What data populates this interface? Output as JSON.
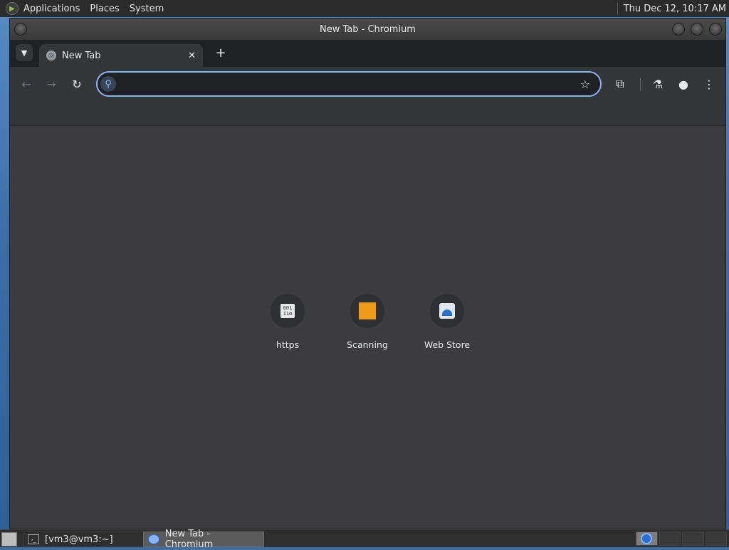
{
  "top_panel": {
    "menus": [
      "Applications",
      "Places",
      "System"
    ],
    "clock": "Thu Dec 12, 10:17 AM"
  },
  "window": {
    "title": "New Tab - Chromium"
  },
  "tabs": [
    {
      "title": "New Tab"
    }
  ],
  "toolbar": {
    "omnibox_value": ""
  },
  "shortcuts": [
    {
      "label": "https",
      "icon": "binary-file-icon"
    },
    {
      "label": "Scanning",
      "icon": "orange-square-icon"
    },
    {
      "label": "Web Store",
      "icon": "web-store-icon"
    }
  ],
  "taskbar": {
    "tasks": [
      {
        "label": "[vm3@vm3:~]",
        "icon": "terminal-icon"
      },
      {
        "label": "New Tab - Chromium",
        "icon": "chromium-icon"
      }
    ]
  },
  "colors": {
    "accent": "#8ab4f8",
    "ntp_background": "#3c3c3f",
    "toolbar_background": "#35363a",
    "tabstrip_background": "#202124"
  }
}
